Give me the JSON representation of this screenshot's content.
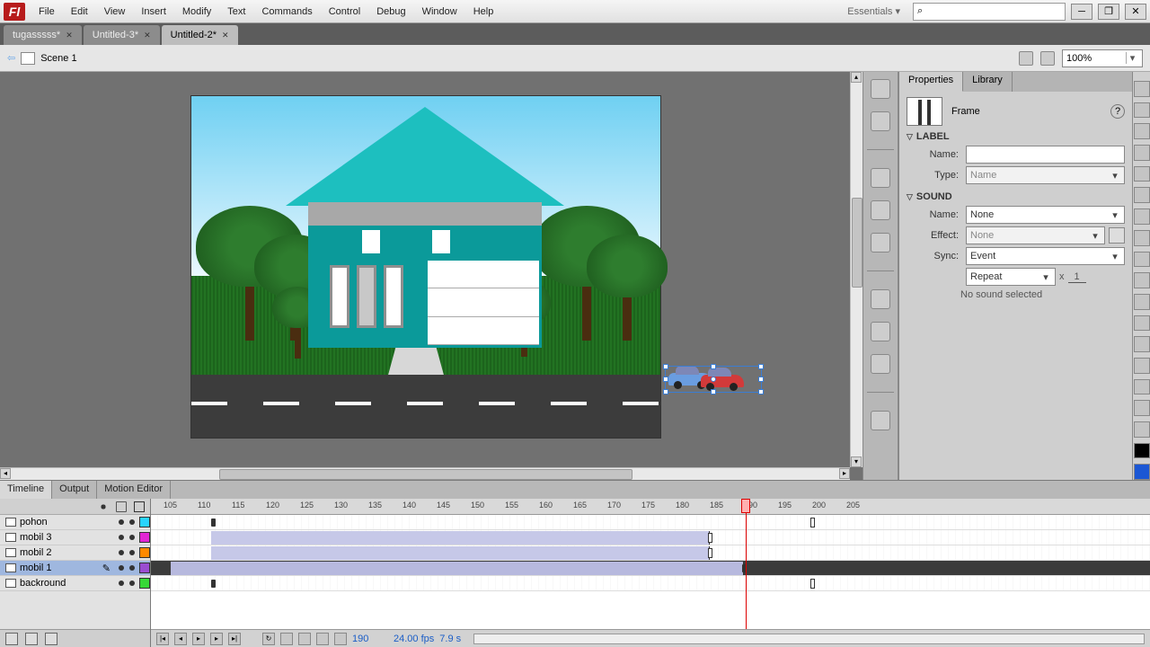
{
  "menu": [
    "File",
    "Edit",
    "View",
    "Insert",
    "Modify",
    "Text",
    "Commands",
    "Control",
    "Debug",
    "Window",
    "Help"
  ],
  "workspace": "Essentials",
  "search_placeholder": "",
  "tabs": [
    {
      "label": "tugasssss*",
      "active": false
    },
    {
      "label": "Untitled-3*",
      "active": false
    },
    {
      "label": "Untitled-2*",
      "active": true
    }
  ],
  "scene": "Scene 1",
  "zoom": "100%",
  "properties": {
    "tabs": [
      "Properties",
      "Library"
    ],
    "title": "Frame",
    "sections": {
      "label": {
        "title": "LABEL",
        "name_label": "Name:",
        "type_label": "Type:",
        "type_value": "Name"
      },
      "sound": {
        "title": "SOUND",
        "name_label": "Name:",
        "name_value": "None",
        "effect_label": "Effect:",
        "effect_value": "None",
        "sync_label": "Sync:",
        "sync_value": "Event",
        "repeat_value": "Repeat",
        "repeat_count": "1",
        "x": "x",
        "message": "No sound selected"
      }
    }
  },
  "timeline": {
    "tabs": [
      "Timeline",
      "Output",
      "Motion Editor"
    ],
    "layers": [
      {
        "name": "pohon",
        "color": "#29d4ff"
      },
      {
        "name": "mobil 3",
        "color": "#e227d4"
      },
      {
        "name": "mobil 2",
        "color": "#ff8a00"
      },
      {
        "name": "mobil 1",
        "color": "#9a4dd1",
        "selected": true
      },
      {
        "name": "backround",
        "color": "#36d836"
      }
    ],
    "ruler_start": 105,
    "ruler_end": 205,
    "ruler_step": 5,
    "playhead": 190,
    "status": {
      "frame": "190",
      "fps": "24.00 fps",
      "time": "7.9 s"
    }
  }
}
